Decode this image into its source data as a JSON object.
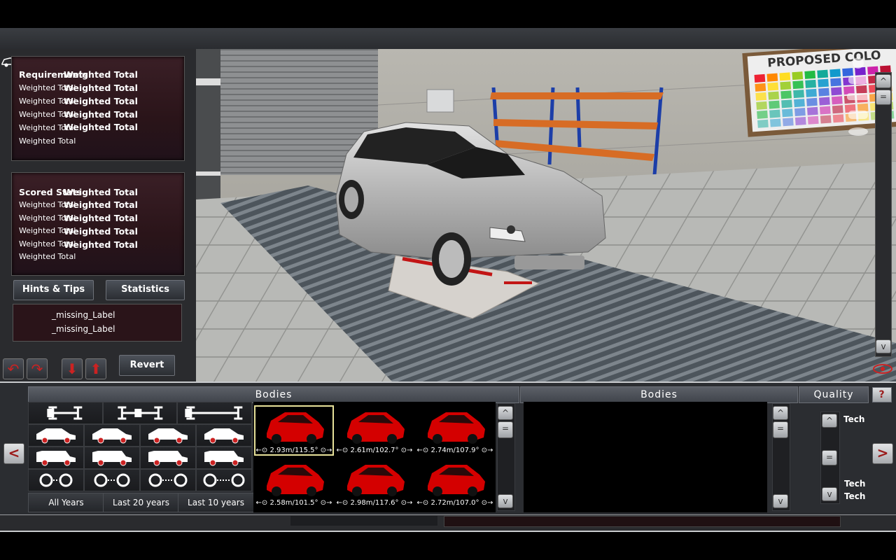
{
  "left_panel": {
    "requirements": {
      "header": "Requirements",
      "header_value": "Weighted Total",
      "rows": [
        {
          "label": "Weighted Total",
          "value": "Weighted Total"
        },
        {
          "label": "Weighted Total",
          "value": "Weighted Total"
        },
        {
          "label": "Weighted Total",
          "value": "Weighted Total"
        },
        {
          "label": "Weighted Total",
          "value": "Weighted Total"
        },
        {
          "label": "Weighted Total",
          "value": ""
        }
      ]
    },
    "scored_stats": {
      "header": "Scored Stats",
      "header_value": "Weighted Total",
      "rows": [
        {
          "label": "Weighted Total",
          "value": "Weighted Total"
        },
        {
          "label": "Weighted Total",
          "value": "Weighted Total"
        },
        {
          "label": "Weighted Total",
          "value": "Weighted Total"
        },
        {
          "label": "Weighted Total",
          "value": "Weighted Total"
        },
        {
          "label": "Weighted Total",
          "value": ""
        }
      ]
    },
    "hints_button": "Hints & Tips",
    "statistics_button": "Statistics",
    "missing_labels": [
      "_missing_Label",
      "_missing_Label"
    ],
    "revert_button": "Revert"
  },
  "scene": {
    "poster_text": "PROPOSED COLO",
    "car_color": "#c4c4c4"
  },
  "bottom": {
    "bodies_header_left": "Bodies",
    "bodies_header_right": "Bodies",
    "quality_header": "Quality",
    "help_label": "?",
    "year_filters": [
      "All Years",
      "Last 20 years",
      "Last 10 years"
    ],
    "bodies": [
      {
        "label": "2.93m/115.5°",
        "selected": true
      },
      {
        "label": "2.61m/102.7°",
        "selected": false
      },
      {
        "label": "2.74m/107.9°",
        "selected": false
      },
      {
        "label": "2.58m/101.5°",
        "selected": false
      },
      {
        "label": "2.98m/117.6°",
        "selected": false
      },
      {
        "label": "2.72m/107.0°",
        "selected": false
      }
    ],
    "quality_labels": [
      "Tech",
      "Tech",
      "Tech"
    ],
    "nav_prev": "<",
    "nav_next": ">"
  },
  "colors": {
    "accent_red": "#d40000",
    "panel_bg": "#2b2d31"
  }
}
